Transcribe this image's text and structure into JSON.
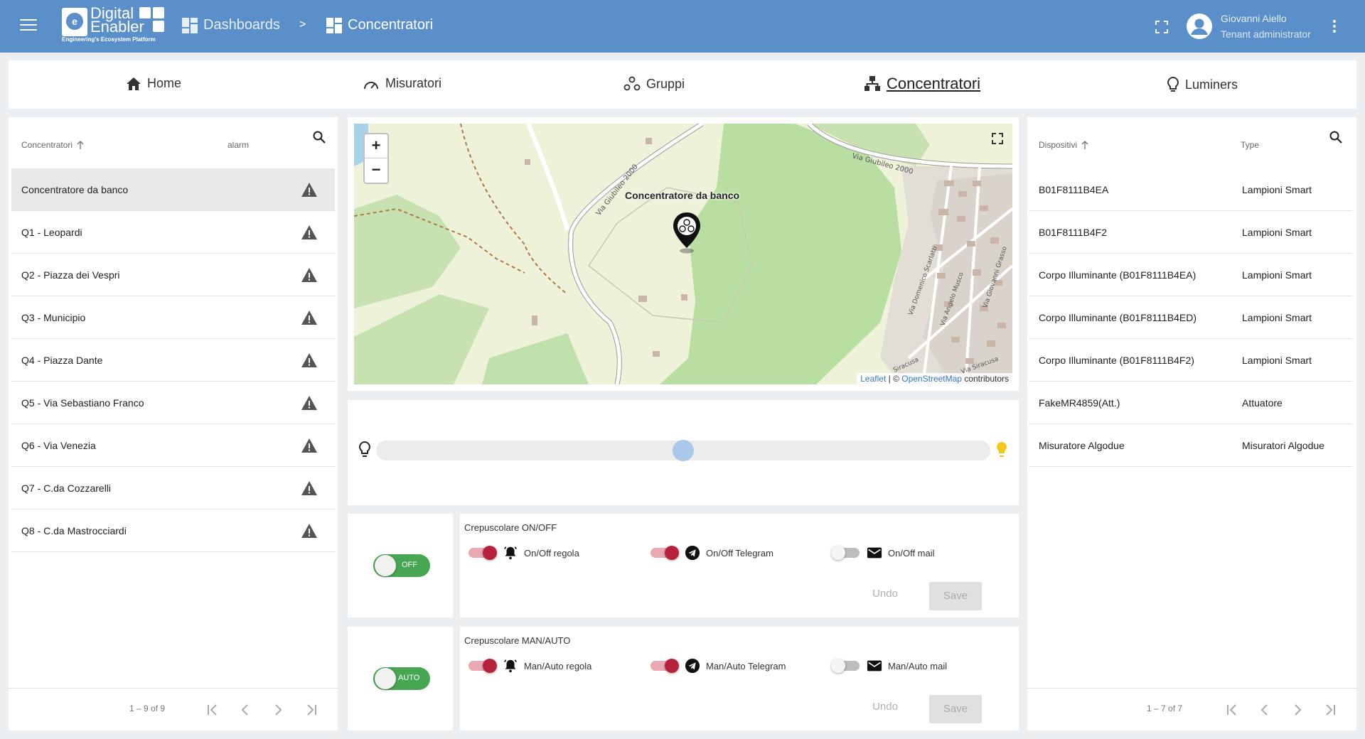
{
  "header": {
    "logo_word1": "Digital",
    "logo_word2": "Enabler",
    "logo_tagline": "Engineering's Ecosystem Platform",
    "breadcrumb_dashboards": "Dashboards",
    "breadcrumb_sep": ">",
    "breadcrumb_current": "Concentratori",
    "user_name": "Giovanni Aiello",
    "user_role": "Tenant administrator"
  },
  "nav": {
    "home": "Home",
    "misuratori": "Misuratori",
    "gruppi": "Gruppi",
    "concentratori": "Concentratori",
    "luminers": "Luminers"
  },
  "left_table": {
    "col1": "Concentratori",
    "col2": "alarm",
    "rows": [
      "Concentratore da banco",
      "Q1 - Leopardi",
      "Q2 - Piazza dei Vespri",
      "Q3 - Municipio",
      "Q4 - Piazza Dante",
      "Q5 - Via Sebastiano Franco",
      "Q6 - Via Venezia",
      "Q7 - C.da Cozzarelli",
      "Q8 - C.da Mastrocciardi"
    ],
    "pager": "1 – 9 of 9"
  },
  "map": {
    "marker_label": "Concentratore da banco",
    "zoom_in": "+",
    "zoom_out": "−",
    "attrib_leaflet": "Leaflet",
    "attrib_sep": " | © ",
    "attrib_osm": "OpenStreetMap",
    "attrib_rest": " contributors",
    "street_labels": [
      "Via Giubileo 2000",
      "Via Giubileo 2000",
      "Via Domenico Scarlatti",
      "Via Angelo Musco",
      "Via Giovanni Grasso",
      "Siracusa",
      "Via Siracusa"
    ]
  },
  "slider": {
    "value_fraction": 0.5
  },
  "crepuscolare_onoff": {
    "toggle_label": "OFF",
    "title": "Crepuscolare ON/OFF",
    "opt1": "On/Off regola",
    "opt2": "On/Off Telegram",
    "opt3": "On/Off mail",
    "undo": "Undo",
    "save": "Save"
  },
  "crepuscolare_manauto": {
    "toggle_label": "AUTO",
    "title": "Crepuscolare MAN/AUTO",
    "opt1": "Man/Auto regola",
    "opt2": "Man/Auto Telegram",
    "opt3": "Man/Auto mail",
    "undo": "Undo",
    "save": "Save"
  },
  "right_table": {
    "col1": "Dispositivi",
    "col2": "Type",
    "rows": [
      {
        "name": "B01F8111B4EA",
        "type": "Lampioni Smart"
      },
      {
        "name": "B01F8111B4F2",
        "type": "Lampioni Smart"
      },
      {
        "name": "Corpo Illuminante (B01F8111B4EA)",
        "type": "Lampioni Smart"
      },
      {
        "name": "Corpo Illuminante (B01F8111B4ED)",
        "type": "Lampioni Smart"
      },
      {
        "name": "Corpo Illuminante (B01F8111B4F2)",
        "type": "Lampioni Smart"
      },
      {
        "name": "FakeMR4859(Att.)",
        "type": "Attuatore"
      },
      {
        "name": "Misuratore Algodue",
        "type": "Misuratori Algodue"
      }
    ],
    "pager": "1 – 7 of 7"
  },
  "colors": {
    "topbar": "#5b8fc9",
    "switch_on": "#b8213b",
    "toggle_green": "#47a652",
    "slider_thumb": "#a9c8ea",
    "bulb_on": "#f5c518"
  }
}
